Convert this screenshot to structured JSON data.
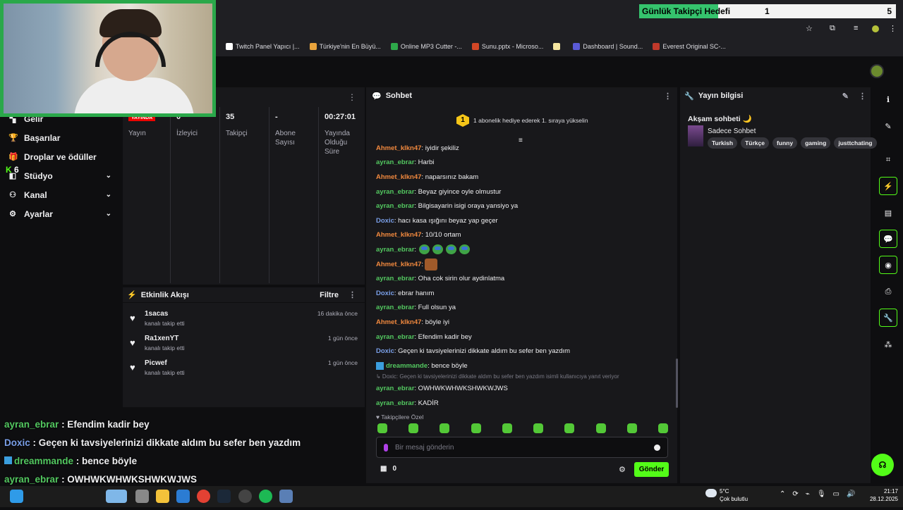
{
  "goal": {
    "label": "Günlük Takipçi Hedefi",
    "current": "1",
    "target": "5"
  },
  "bookmarks": [
    {
      "label": "Twitch Panel Yapıcı |...",
      "color": "#ffffff"
    },
    {
      "label": "Türkiye'nin En Büyü...",
      "color": "#e8a33c"
    },
    {
      "label": "Online MP3 Cutter -...",
      "color": "#2ea84a"
    },
    {
      "label": "Sunu.pptx - Microso...",
      "color": "#d24726"
    },
    {
      "label": "",
      "color": "#f5e6a0"
    },
    {
      "label": "Dashboard | Sound...",
      "color": "#5a5ad6"
    },
    {
      "label": "Everest Original SC-...",
      "color": "#c0392b"
    }
  ],
  "sidebar": {
    "items": [
      {
        "label": "Gelir",
        "icon": "chart-icon"
      },
      {
        "label": "Başarılar",
        "icon": "trophy-icon"
      },
      {
        "label": "Droplar ve ödüller",
        "icon": "gift-icon"
      },
      {
        "label": "Stüdyo",
        "icon": "studio-icon",
        "chevron": "⌄"
      },
      {
        "label": "Kanal",
        "icon": "people-icon",
        "chevron": "⌄"
      },
      {
        "label": "Ayarlar",
        "icon": "gear-icon",
        "chevron": "⌄"
      }
    ],
    "k_badge": "K",
    "k_count": "6"
  },
  "stats": {
    "live_label": "YAYINDA",
    "live_caption": "Yayın",
    "items": [
      {
        "value": "0",
        "label": "İzleyici"
      },
      {
        "value": "35",
        "label": "Takipçi"
      },
      {
        "value": "-",
        "label": "Abone Sayısı"
      },
      {
        "value": "00:27:01",
        "label": "Yayında Olduğu Süre"
      }
    ]
  },
  "feed": {
    "title": "Etkinlik Akışı",
    "filter": "Filtre",
    "events": [
      {
        "user": "1sacas",
        "sub": "kanalı takip etti",
        "time": "16 dakika önce"
      },
      {
        "user": "Ra1xenYT",
        "sub": "kanalı takip etti",
        "time": "1 gün önce"
      },
      {
        "user": "Picwef",
        "sub": "kanalı takip etti",
        "time": "1 gün önce"
      }
    ]
  },
  "overlay": [
    {
      "name": "ayran_ebrar",
      "color": "#53c860",
      "text": " : Efendim kadir bey"
    },
    {
      "name": "Doxic",
      "color": "#7a9fe8",
      "text": " : Geçen ki tavsiyelerinizi dikkate aldım bu sefer ben yazdım"
    },
    {
      "name": "dreammande",
      "color": "#53c860",
      "text": " : bence böyle",
      "badge": true
    },
    {
      "name": "ayran_ebrar",
      "color": "#53c860",
      "text": " : OWHWKWHWKSHWKWJWS"
    },
    {
      "name": "ayran_ebrar",
      "color": "#53c860",
      "text": " : KADİR"
    }
  ],
  "chat": {
    "title": "Sohbet",
    "gift_num": "1",
    "gift_text": "1 abonelik hediye ederek 1. sıraya yükselin",
    "messages": [
      {
        "name": "Ahmet_klkn47",
        "color": "#f0883e",
        "text": ": iyidir şekiliz"
      },
      {
        "name": "ayran_ebrar",
        "color": "#53c860",
        "text": ": Harbi"
      },
      {
        "name": "Ahmet_klkn47",
        "color": "#f0883e",
        "text": ": naparsınız bakam"
      },
      {
        "name": "ayran_ebrar",
        "color": "#53c860",
        "text": ": Beyaz giyince oyle olmustur"
      },
      {
        "name": "ayran_ebrar",
        "color": "#53c860",
        "text": ": Bilgisayarin isigi oraya yansiyo ya"
      },
      {
        "name": "Doxic",
        "color": "#7a9fe8",
        "text": ": hacı kasa ışığını beyaz yap geçer"
      },
      {
        "name": "Ahmet_klkn47",
        "color": "#f0883e",
        "text": ": 10/10 ortam"
      },
      {
        "name": "ayran_ebrar",
        "color": "#53c860",
        "text": ":",
        "emotes": 4
      },
      {
        "name": "Ahmet_klkn47",
        "color": "#f0883e",
        "text": ":",
        "cookie": true
      },
      {
        "name": "ayran_ebrar",
        "color": "#53c860",
        "text": ": Oha cok sirin olur aydinlatma"
      },
      {
        "name": "Doxic",
        "color": "#7a9fe8",
        "text": ": ebrar hanım"
      },
      {
        "name": "ayran_ebrar",
        "color": "#53c860",
        "text": ": Full olsun ya"
      },
      {
        "name": "Ahmet_klkn47",
        "color": "#f0883e",
        "text": ": böyle iyi"
      },
      {
        "name": "ayran_ebrar",
        "color": "#53c860",
        "text": ": Efendim kadir bey"
      },
      {
        "name": "Doxic",
        "color": "#7a9fe8",
        "text": ": Geçen ki tavsiyelerinizi dikkate aldım bu sefer ben yazdım"
      },
      {
        "name": "dreammande",
        "color": "#53c860",
        "text": ": bence böyle",
        "badge": true
      }
    ],
    "reply_text": "↳ Doxic: Geçen ki tavsiyelerinizi dikkate aldım bu sefer ben yazdım isimli kullanıcıya yanıt veriyor",
    "after": [
      {
        "name": "ayran_ebrar",
        "color": "#53c860",
        "text": ": OWHWKWHWKSHWKWJWS"
      },
      {
        "name": "ayran_ebrar",
        "color": "#53c860",
        "text": ": KADİR"
      }
    ],
    "sub_only": "♥ Takipçilere Özel",
    "input_placeholder": "Bir mesaj gönderin",
    "points": "0",
    "send_label": "Gönder"
  },
  "info": {
    "title": "Yayın bilgisi",
    "stream_title": "Akşam sohbeti 🌙",
    "category": "Sadece Sohbet",
    "tags": [
      "Turkish",
      "Türkçe",
      "funny",
      "gaming",
      "justtchating"
    ]
  },
  "taskbar": {
    "weather_temp": "5°C",
    "weather_desc": "Çok bulutlu",
    "time": "21:17",
    "date": "28.12.2025"
  },
  "colors": {
    "accent": "#53fc18",
    "live": "#eb0400",
    "goal": "#35c36d"
  }
}
